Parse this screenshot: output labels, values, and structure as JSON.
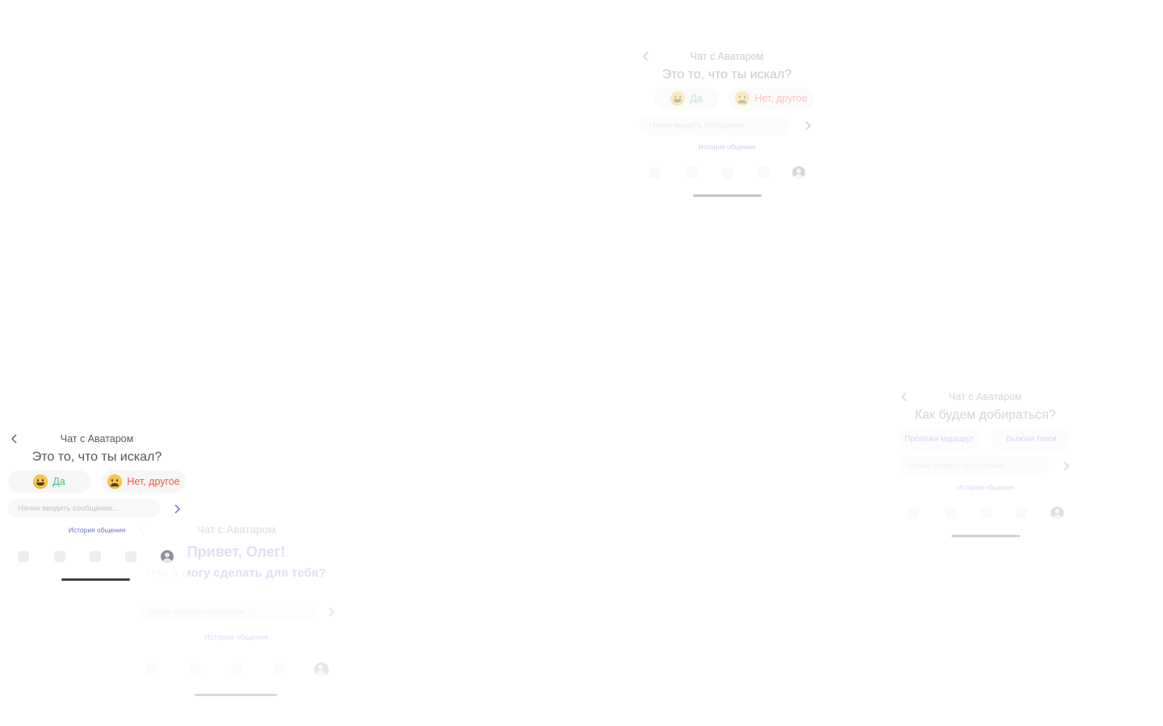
{
  "screens": [
    {
      "id": "top-right",
      "header_title": "Чат с Аватаром",
      "question": "Это то, что ты искал?",
      "chip_yes": "Да",
      "chip_no": "Нет, другое",
      "input_placeholder": "Начни вводить сообщение...",
      "history_link": "История общения"
    },
    {
      "id": "right",
      "header_title": "Чат с Аватаром",
      "question": "Как будем добираться?",
      "chip_route": "Проложи маршрут",
      "chip_taxi": "Вызови такси",
      "input_placeholder": "Начни вводить сообщение...",
      "history_link": "История общения"
    },
    {
      "id": "bottom-left",
      "header_title": "Чат с Аватаром",
      "question": "Это то, что ты искал?",
      "chip_yes": "Да",
      "chip_no": "Нет, другое",
      "input_placeholder": "Начни вводить сообщение...",
      "history_link": "История общения"
    },
    {
      "id": "bottom-center",
      "header_title": "Чат с Аватаром",
      "greeting": "Привет, Олег!",
      "question": "Что я могу сделать для тебя?",
      "input_placeholder": "Начни вводить сообщение...",
      "history_link": "История общения"
    }
  ],
  "colors": {
    "yes": "#43c065",
    "no": "#f0564b",
    "link": "#6d72c9",
    "text": "#6b6b6b"
  }
}
